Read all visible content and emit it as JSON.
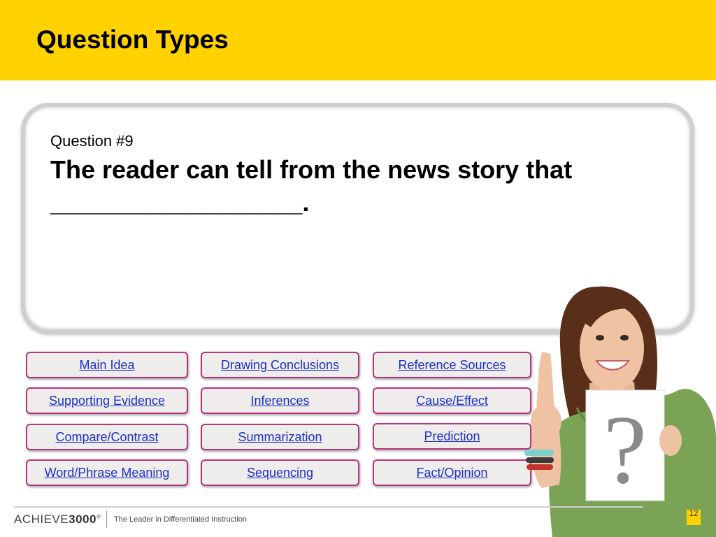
{
  "header": {
    "title": "Question Types"
  },
  "question": {
    "number": "Question #9",
    "text": "The reader can tell from the news story that __________________."
  },
  "buttons": [
    {
      "label": "Main Idea"
    },
    {
      "label": "Drawing Conclusions"
    },
    {
      "label": "Reference Sources"
    },
    {
      "label": "Supporting Evidence"
    },
    {
      "label": "Inferences"
    },
    {
      "label": "Cause/Effect"
    },
    {
      "label": "Compare/Contrast"
    },
    {
      "label": "Summarization"
    },
    {
      "label": "Prediction"
    },
    {
      "label": "Word/Phrase Meaning"
    },
    {
      "label": "Sequencing"
    },
    {
      "label": "Fact/Opinion"
    }
  ],
  "illustration": {
    "sign_text": "?"
  },
  "footer": {
    "brand_prefix": "ACHIEVE",
    "brand_suffix": "3000",
    "trademark": "®",
    "tagline": "The Leader in Differentiated Instruction",
    "slide_number": "12"
  },
  "colors": {
    "header_bg": "#ffd200",
    "button_border": "#b6357e",
    "link": "#1d2fc9",
    "button_bg": "#efedeb"
  }
}
